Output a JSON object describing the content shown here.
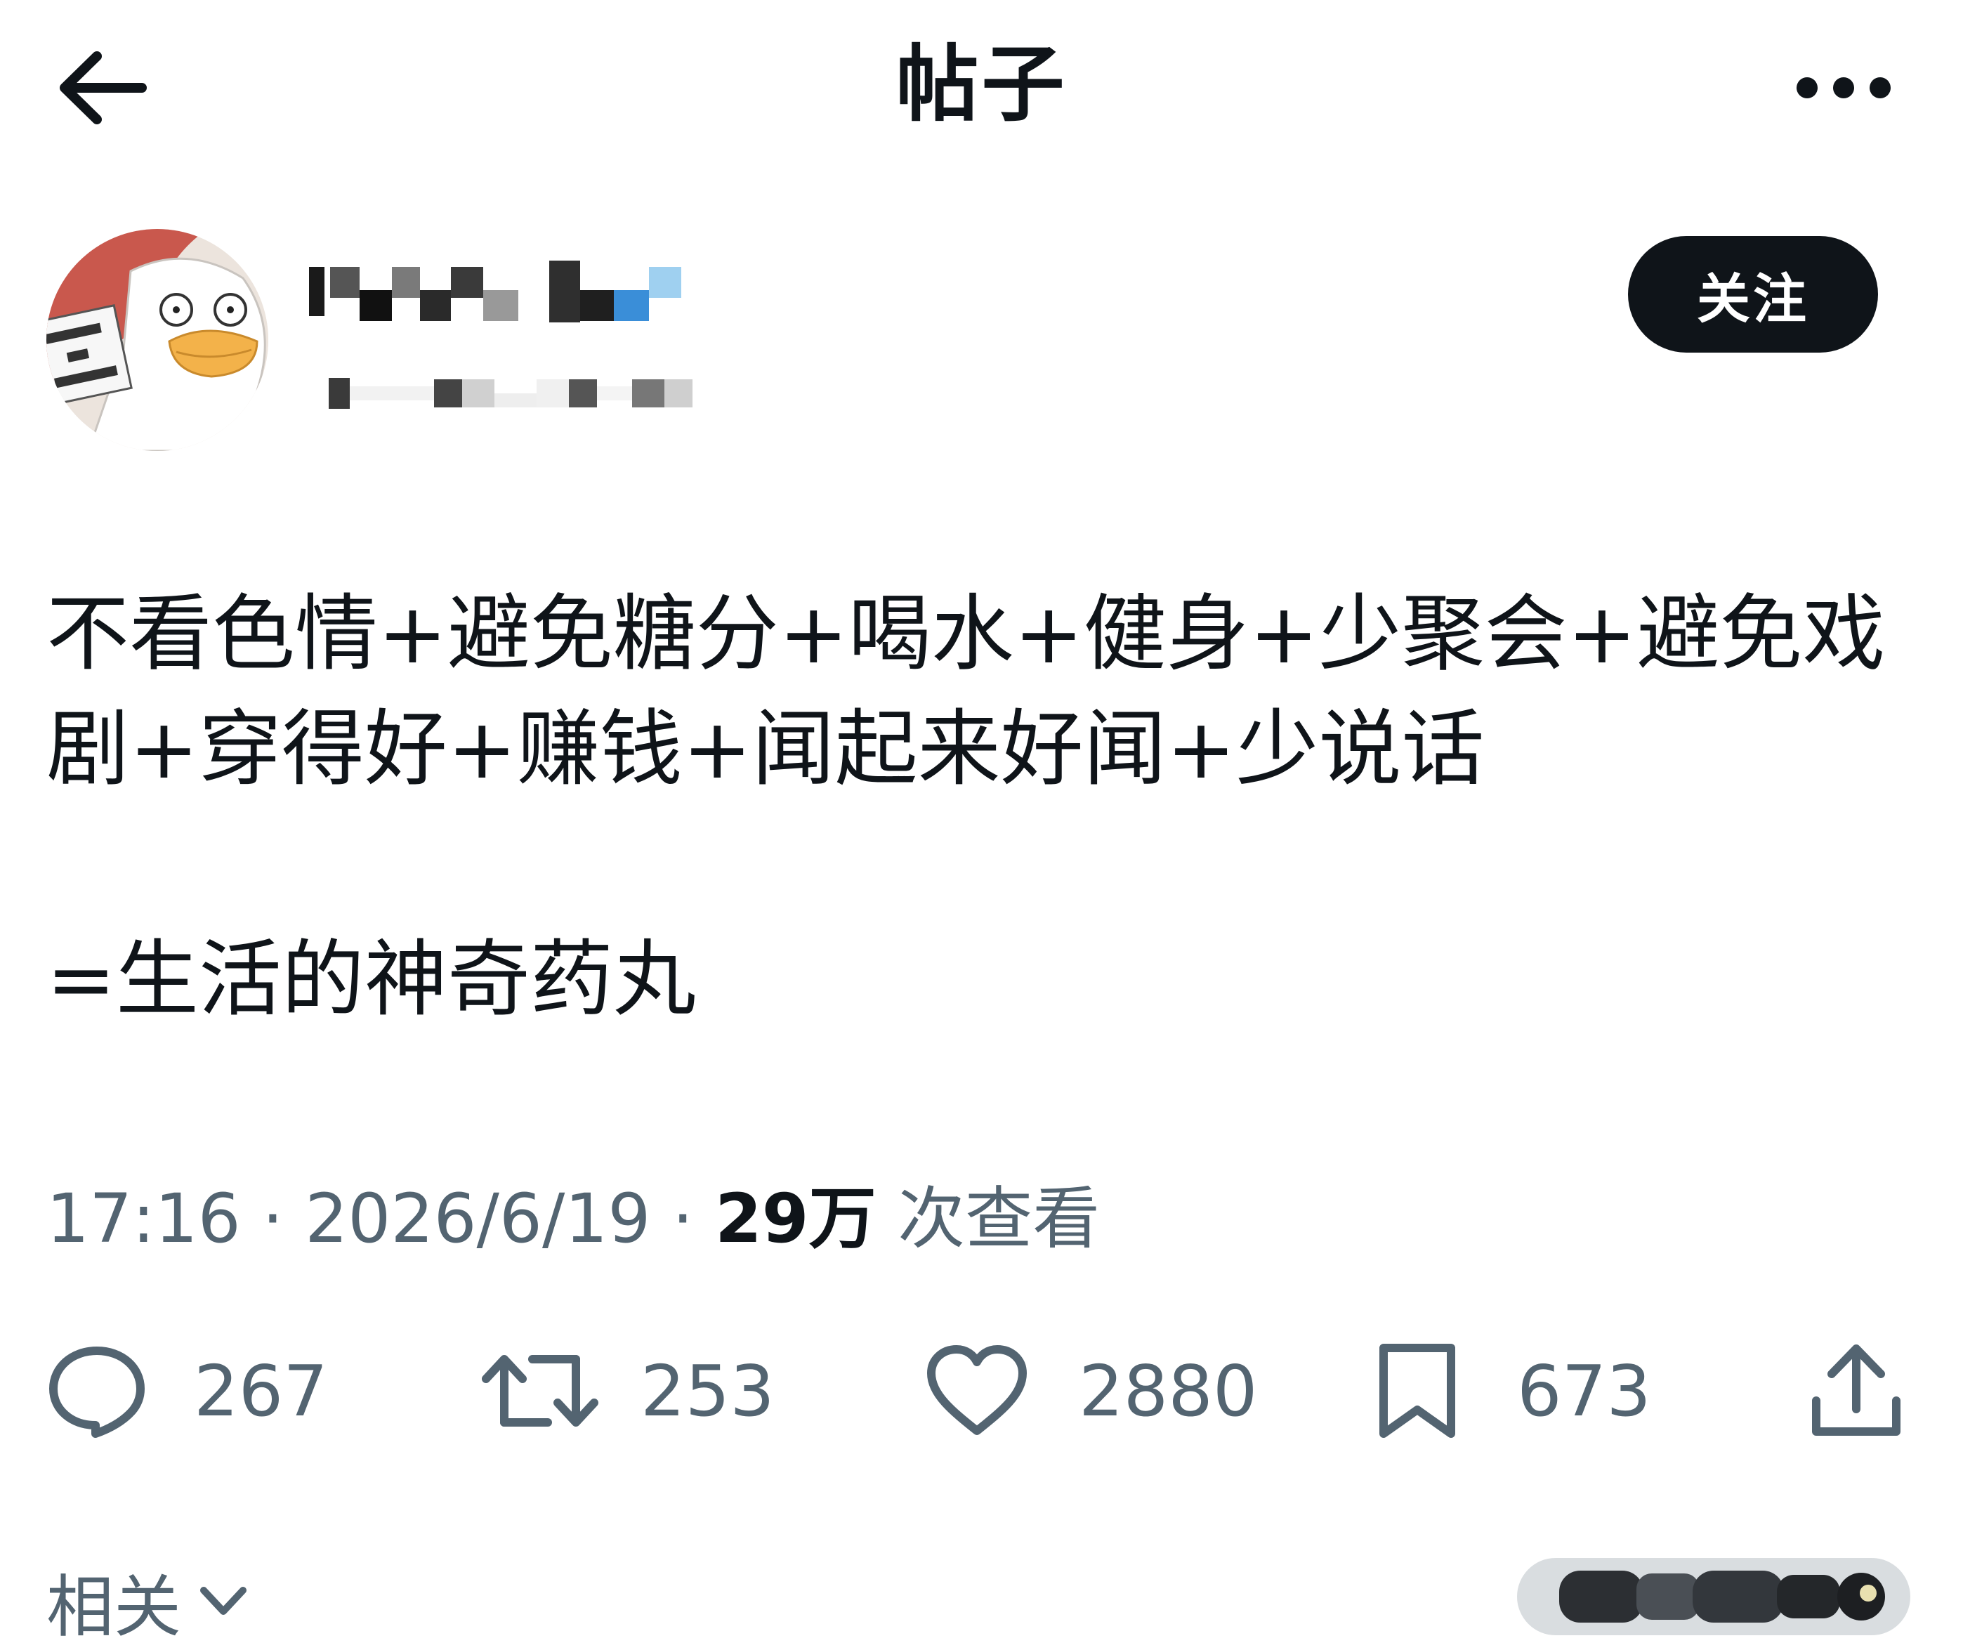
{
  "header": {
    "title": "帖子",
    "back_icon": "arrow-left-icon",
    "more_icon": "more-horizontal-icon"
  },
  "author": {
    "avatar_icon": "duck-avatar",
    "follow_label": "关注"
  },
  "post": {
    "line1": "不看色情+避免糖分+喝水+健身+少聚会+避免戏",
    "line2": "剧+穿得好+赚钱+闻起来好闻+少说话",
    "line3": "=生活的神奇药丸"
  },
  "meta": {
    "time": "17:16",
    "separator": " · ",
    "date": "2026/6/19",
    "views": "29万",
    "views_label": " 次查看"
  },
  "actions": {
    "replies": "267",
    "reposts": "253",
    "likes": "2880",
    "bookmarks": "673"
  },
  "related": {
    "label": "相关"
  },
  "colors": {
    "text": "#0f1419",
    "secondary": "#536471",
    "background": "#ffffff",
    "button": "#0f1419"
  }
}
